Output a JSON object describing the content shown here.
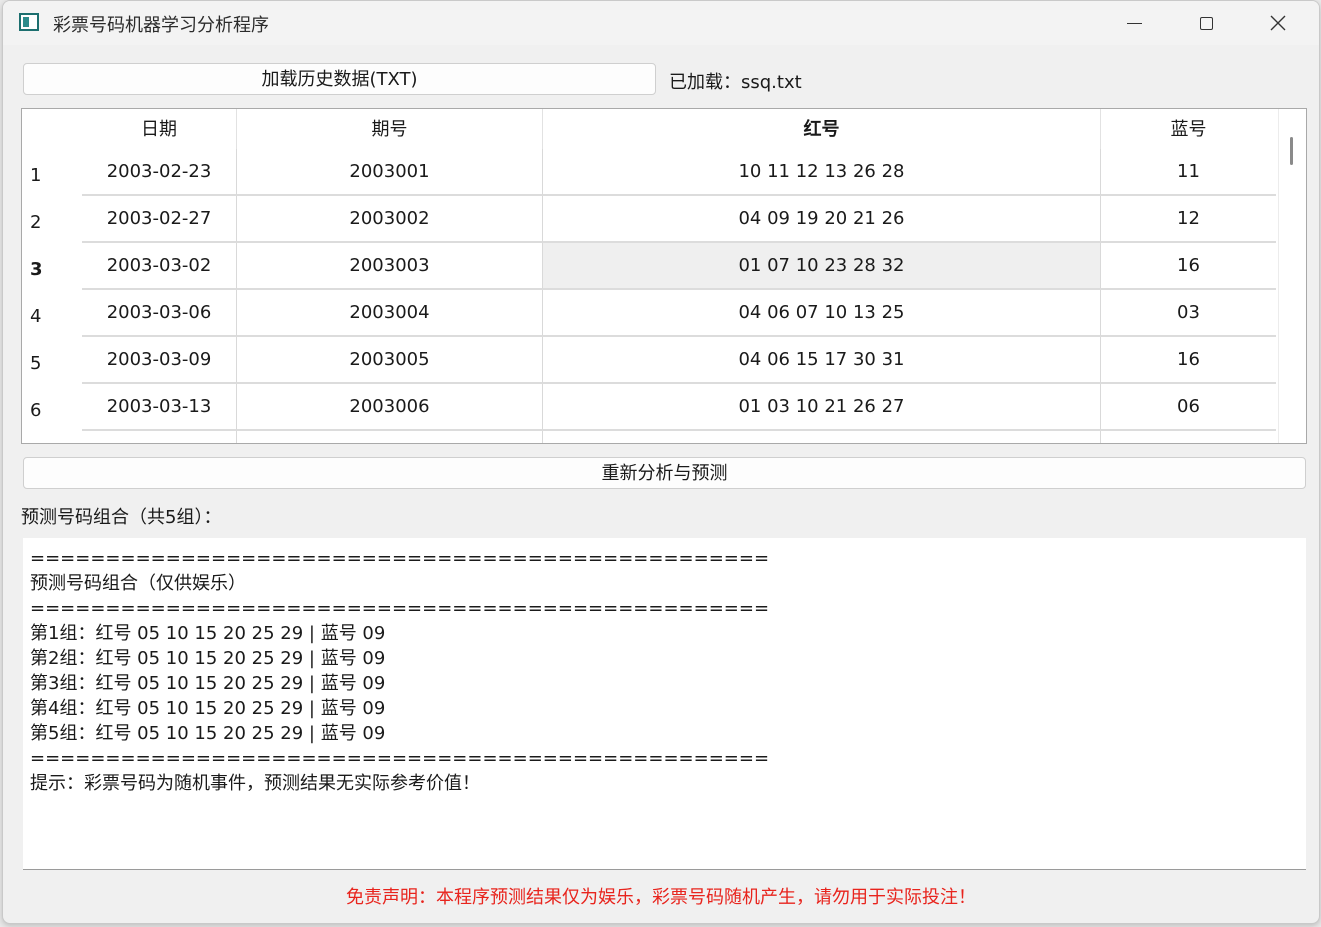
{
  "window": {
    "title": "彩票号码机器学习分析程序"
  },
  "toolbar": {
    "load_label": "加载历史数据(TXT)",
    "loaded_text": "已加载：ssq.txt"
  },
  "table": {
    "headers": [
      "日期",
      "期号",
      "红号",
      "蓝号"
    ],
    "rows": [
      {
        "num": "1",
        "date": "2003-02-23",
        "issue": "2003001",
        "red": "10 11 12 13 26 28",
        "blue": "11"
      },
      {
        "num": "2",
        "date": "2003-02-27",
        "issue": "2003002",
        "red": "04 09 19 20 21 26",
        "blue": "12"
      },
      {
        "num": "3",
        "date": "2003-03-02",
        "issue": "2003003",
        "red": "01 07 10 23 28 32",
        "blue": "16"
      },
      {
        "num": "4",
        "date": "2003-03-06",
        "issue": "2003004",
        "red": "04 06 07 10 13 25",
        "blue": "03"
      },
      {
        "num": "5",
        "date": "2003-03-09",
        "issue": "2003005",
        "red": "04 06 15 17 30 31",
        "blue": "16"
      },
      {
        "num": "6",
        "date": "2003-03-13",
        "issue": "2003006",
        "red": "01 03 10 21 26 27",
        "blue": "06"
      }
    ]
  },
  "actions": {
    "analyze_label": "重新分析与预测"
  },
  "prediction": {
    "label": "预测号码组合（共5组）：",
    "lines": [
      "=================================================",
      "预测号码组合（仅供娱乐）",
      "=================================================",
      "第1组：红号 05 10 15 20 25 29 | 蓝号 09",
      "第2组：红号 05 10 15 20 25 29 | 蓝号 09",
      "第3组：红号 05 10 15 20 25 29 | 蓝号 09",
      "第4组：红号 05 10 15 20 25 29 | 蓝号 09",
      "第5组：红号 05 10 15 20 25 29 | 蓝号 09",
      "=================================================",
      "提示：彩票号码为随机事件，预测结果无实际参考价值！"
    ]
  },
  "footer": {
    "disclaimer": "免责声明：本程序预测结果仅为娱乐，彩票号码随机产生，请勿用于实际投注！",
    "disclaimer_color": "#e8241d"
  },
  "icons": {
    "app": "app-window-icon",
    "minimize": "minimize-icon",
    "maximize": "maximize-icon",
    "close": "close-icon"
  }
}
